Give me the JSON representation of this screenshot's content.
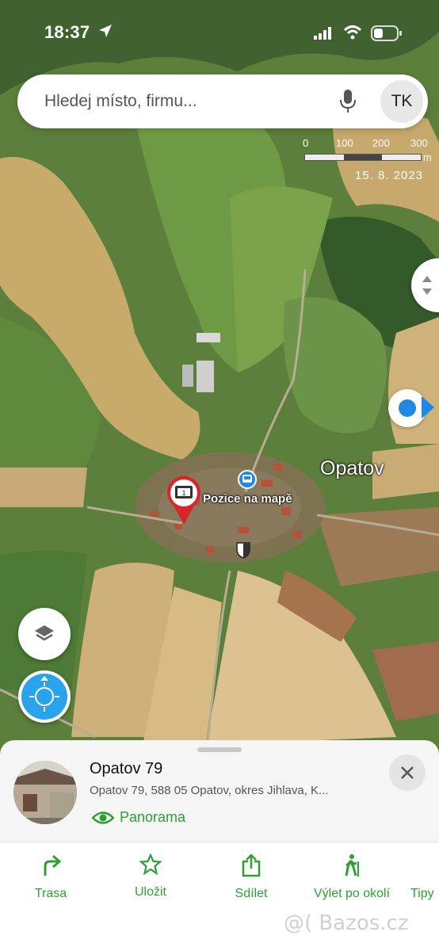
{
  "status_bar": {
    "time": "18:37"
  },
  "search": {
    "placeholder": "Hledej místo, firmu...",
    "avatar": "TK"
  },
  "scale": {
    "ticks": [
      "0",
      "100",
      "200",
      "300"
    ],
    "unit": "m",
    "date": "15. 8. 2023"
  },
  "map": {
    "place_label": "Opatov",
    "pin_label": "Pozice na mapě",
    "icons": [
      "location-arrow-icon",
      "microphone-icon",
      "my-location-icon",
      "bus-stop-icon",
      "church-shield-icon",
      "layers-icon",
      "compass-icon"
    ]
  },
  "place": {
    "title": "Opatov 79",
    "address": "Opatov 79, 588 05 Opatov, okres Jihlava, K...",
    "panorama": "Panorama"
  },
  "actions": [
    {
      "label": "Trasa",
      "icon": "route-icon"
    },
    {
      "label": "Uložit",
      "icon": "star-icon"
    },
    {
      "label": "Sdílet",
      "icon": "share-icon"
    },
    {
      "label": "Výlet po okolí",
      "icon": "hiker-icon"
    },
    {
      "label": "Tipy",
      "icon": "tips-icon"
    }
  ],
  "watermark": "@( Bazos.cz",
  "colors": {
    "accent_green": "#2e9f35",
    "location_blue": "#1e88e5",
    "pin_red": "#d7262c"
  }
}
